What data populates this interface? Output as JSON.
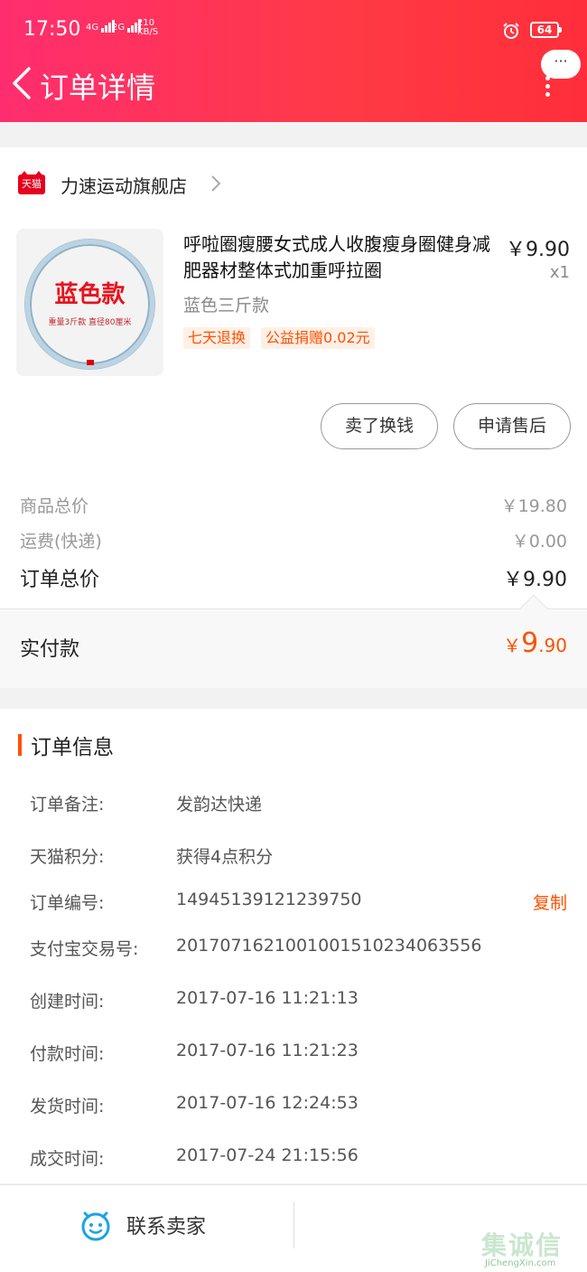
{
  "status_bar": {
    "time": "17:50",
    "signal_1": "4G",
    "signal_2": "2G",
    "speed_value": "210",
    "speed_unit": "KB/S",
    "battery": "64"
  },
  "header": {
    "title": "订单详情",
    "back_icon": "chevron-left-icon",
    "more_bubble": "···",
    "menu_icon": "kebab-menu-icon",
    "gradient_start": "#ff2d6f",
    "gradient_end": "#ff2e3a"
  },
  "shop": {
    "badge": "天猫",
    "name": "力速运动旗舰店"
  },
  "product": {
    "image_label": "蓝色款",
    "image_sub": "重量3斤款 直径80厘米",
    "name": "呼啦圈瘦腰女式成人收腹瘦身圈健身减肥器材整体式加重呼拉圈",
    "price": "￥9.90",
    "quantity": "x1",
    "spec": "蓝色三斤款",
    "tags": [
      "七天退换",
      "公益捐赠0.02元"
    ]
  },
  "actions": {
    "sell_label": "卖了换钱",
    "after_sale_label": "申请售后"
  },
  "summary": {
    "goods_label": "商品总价",
    "goods_value": "￥19.80",
    "shipping_label": "运费(快递)",
    "shipping_value": "￥0.00",
    "total_label": "订单总价",
    "total_value": "￥9.90",
    "paid_label": "实付款",
    "paid_yen": "￥",
    "paid_int": "9",
    "paid_dec": ".90",
    "accent_color": "#ff5000"
  },
  "order_info": {
    "title": "订单信息",
    "rows": [
      {
        "key": "订单备注:",
        "value": "发韵达快递"
      },
      {
        "key": "天猫积分:",
        "value": "获得4点积分"
      },
      {
        "key": "订单编号:",
        "value": "14945139121239750"
      },
      {
        "key": "支付宝交易号:",
        "value": "2017071621001001510234063556"
      },
      {
        "key": "创建时间:",
        "value": "2017-07-16 11:21:13"
      },
      {
        "key": "付款时间:",
        "value": "2017-07-16 11:21:23"
      },
      {
        "key": "发货时间:",
        "value": "2017-07-16 12:24:53"
      },
      {
        "key": "成交时间:",
        "value": "2017-07-24 21:15:56"
      }
    ],
    "copy_label": "复制"
  },
  "bottom_bar": {
    "contact_label": "联系卖家",
    "contact_icon": "chat-face-icon"
  },
  "watermark": {
    "cn": "集诚信",
    "en": "JiChengXin.com"
  }
}
